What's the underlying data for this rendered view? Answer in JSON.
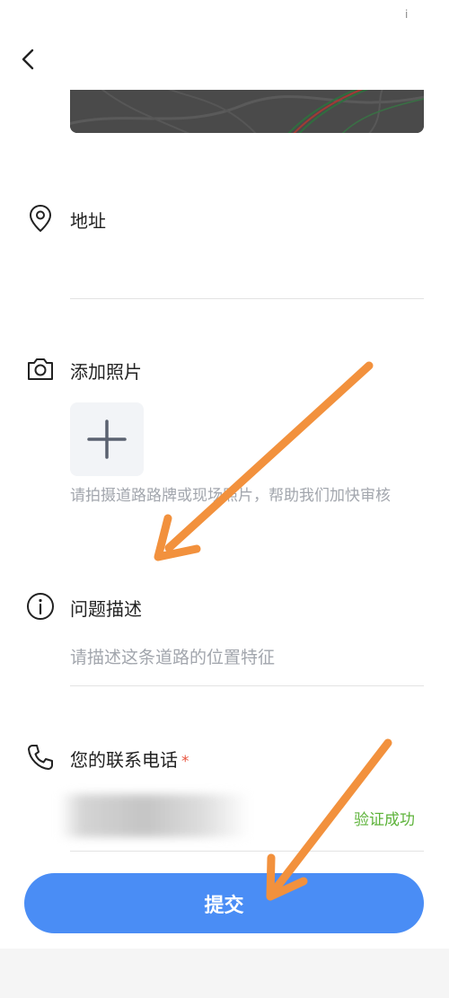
{
  "status": {
    "mark": "ⅰ"
  },
  "address": {
    "label": "地址"
  },
  "photo": {
    "label": "添加照片",
    "hint": "请拍摄道路路牌或现场照片，帮助我们加快审核"
  },
  "description": {
    "label": "问题描述",
    "placeholder": "请描述这条道路的位置特征"
  },
  "contact": {
    "label": "您的联系电话",
    "required_mark": "*",
    "verify_status": "验证成功",
    "verify_color": "#5db33a"
  },
  "submit": {
    "label": "提交",
    "color": "#4a8df5"
  },
  "annotations": {
    "arrow_color": "#f2913d"
  }
}
